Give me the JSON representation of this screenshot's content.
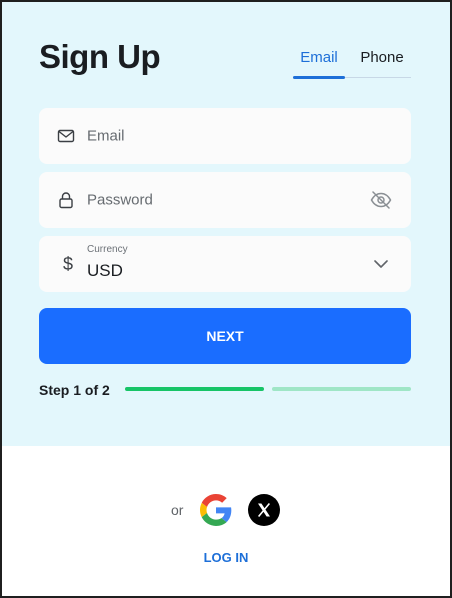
{
  "header": {
    "title": "Sign Up"
  },
  "tabs": [
    {
      "label": "Email",
      "active": true
    },
    {
      "label": "Phone",
      "active": false
    }
  ],
  "form": {
    "email": {
      "placeholder": "Email",
      "icon": "mail-icon"
    },
    "password": {
      "placeholder": "Password",
      "icon": "lock-icon",
      "toggle_icon": "eye-off-icon"
    },
    "currency": {
      "label": "Currency",
      "value": "USD",
      "symbol": "$",
      "icon": "chevron-down-icon"
    },
    "next_label": "NEXT"
  },
  "progress": {
    "label": "Step 1 of 2",
    "current_step": 1,
    "total_steps": 2
  },
  "footer": {
    "or_text": "or",
    "social": [
      "google-icon",
      "x-icon"
    ],
    "login_label": "LOG IN"
  },
  "colors": {
    "accent": "#1a6dff",
    "tab_active": "#1d6fd8",
    "progress_active": "#17c467",
    "progress_inactive": "#9fe6c6",
    "panel_bg": "#e3f7fc"
  }
}
